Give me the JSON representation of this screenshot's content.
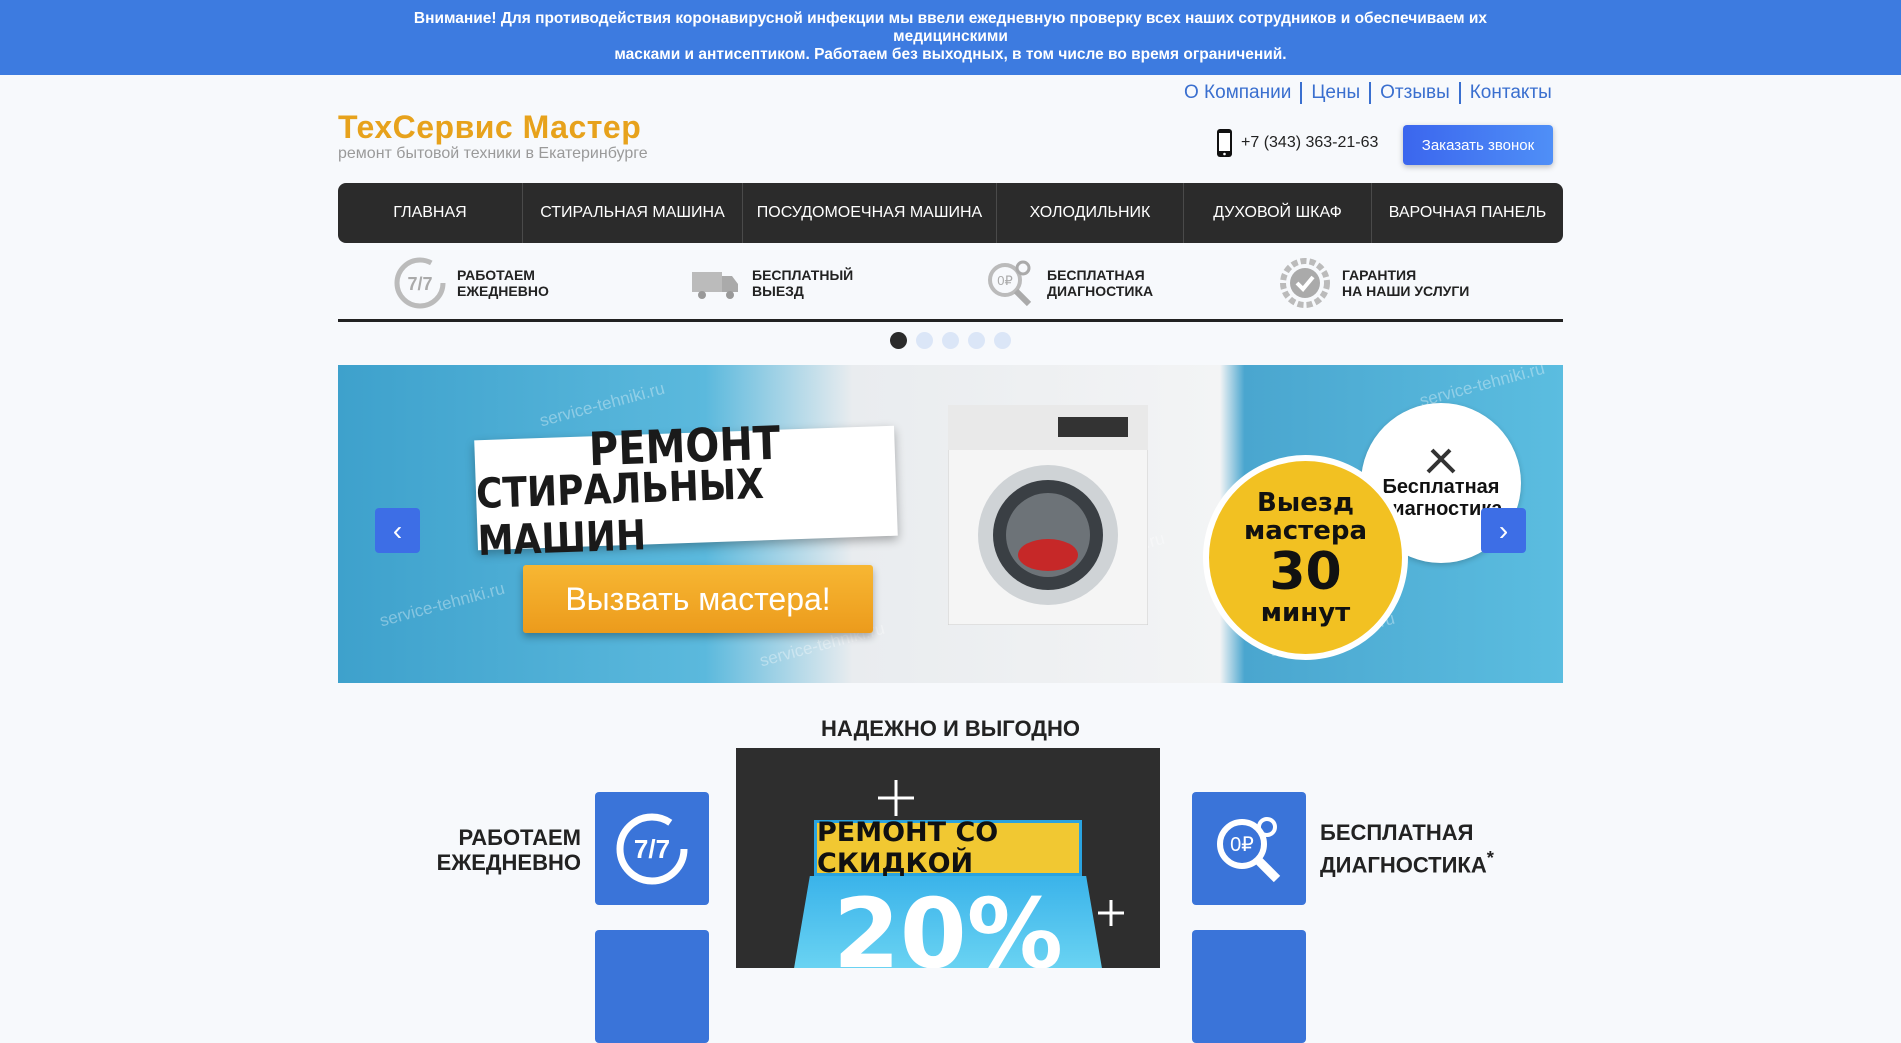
{
  "alert": {
    "line1": "Внимание! Для противодействия коронавирусной инфекции мы ввели ежедневную проверку всех наших сотрудников и обеспечиваем их медицинскими",
    "line2": "масками и антисептиком. Работаем без выходных, в том числе во время ограничений."
  },
  "top_links": [
    "О Компании",
    "Цены",
    "Отзывы",
    "Контакты"
  ],
  "logo": {
    "title": "ТехСервис Мастер",
    "subtitle": "ремонт бытовой техники в Екатеринбурге"
  },
  "phone": "+7 (343) 363-21-63",
  "call_button": "Заказать звонок",
  "nav": [
    "ГЛАВНАЯ",
    "СТИРАЛЬНАЯ МАШИНА",
    "ПОСУДОМОЕЧНАЯ МАШИНА",
    "ХОЛОДИЛЬНИК",
    "ДУХОВОЙ ШКАФ",
    "ВАРОЧНАЯ ПАНЕЛЬ"
  ],
  "features": [
    {
      "line1": "РАБОТАЕМ",
      "line2": "ЕЖЕДНЕВНО",
      "icon": "clock-7-7-icon"
    },
    {
      "line1": "БЕСПЛАТНЫЙ",
      "line2": "ВЫЕЗД",
      "icon": "truck-icon"
    },
    {
      "line1": "БЕСПЛАТНАЯ",
      "line2": "ДИАГНОСТИКА",
      "icon": "magnifier-gear-icon"
    },
    {
      "line1": "ГАРАНТИЯ",
      "line2": "НА НАШИ УСЛУГИ",
      "icon": "gear-check-icon"
    }
  ],
  "slider": {
    "sign_line1": "РЕМОНТ",
    "sign_line2": "СТИРАЛЬНЫХ МАШИН",
    "cta": "Вызвать мастера!",
    "badge_line1": "Выезд",
    "badge_line2": "мастера",
    "badge_num": "30",
    "badge_line3": "минут",
    "diag_line1": "Бесплатная",
    "diag_line2": "диагностика",
    "watermark": "service-tehniki.ru",
    "prev": "‹",
    "next": "›",
    "slide_count": 5,
    "active_slide": 1
  },
  "section": {
    "title": "НАДЕЖНО И ВЫГОДНО",
    "promo_ribbon": "РЕМОНТ СО СКИДКОЙ",
    "promo_value": "20%",
    "left_label_1": "РАБОТАЕМ",
    "left_label_2": "ЕЖЕДНЕВНО",
    "right_label_1": "БЕСПЛАТНАЯ",
    "right_label_2": "ДИАГНОСТИКА",
    "right_label_mark": "*"
  },
  "colors": {
    "alert_bg": "#3d7be0",
    "brand": "#e7a21c",
    "nav_bg": "#2b2b2b",
    "accent": "#3a74d9"
  }
}
